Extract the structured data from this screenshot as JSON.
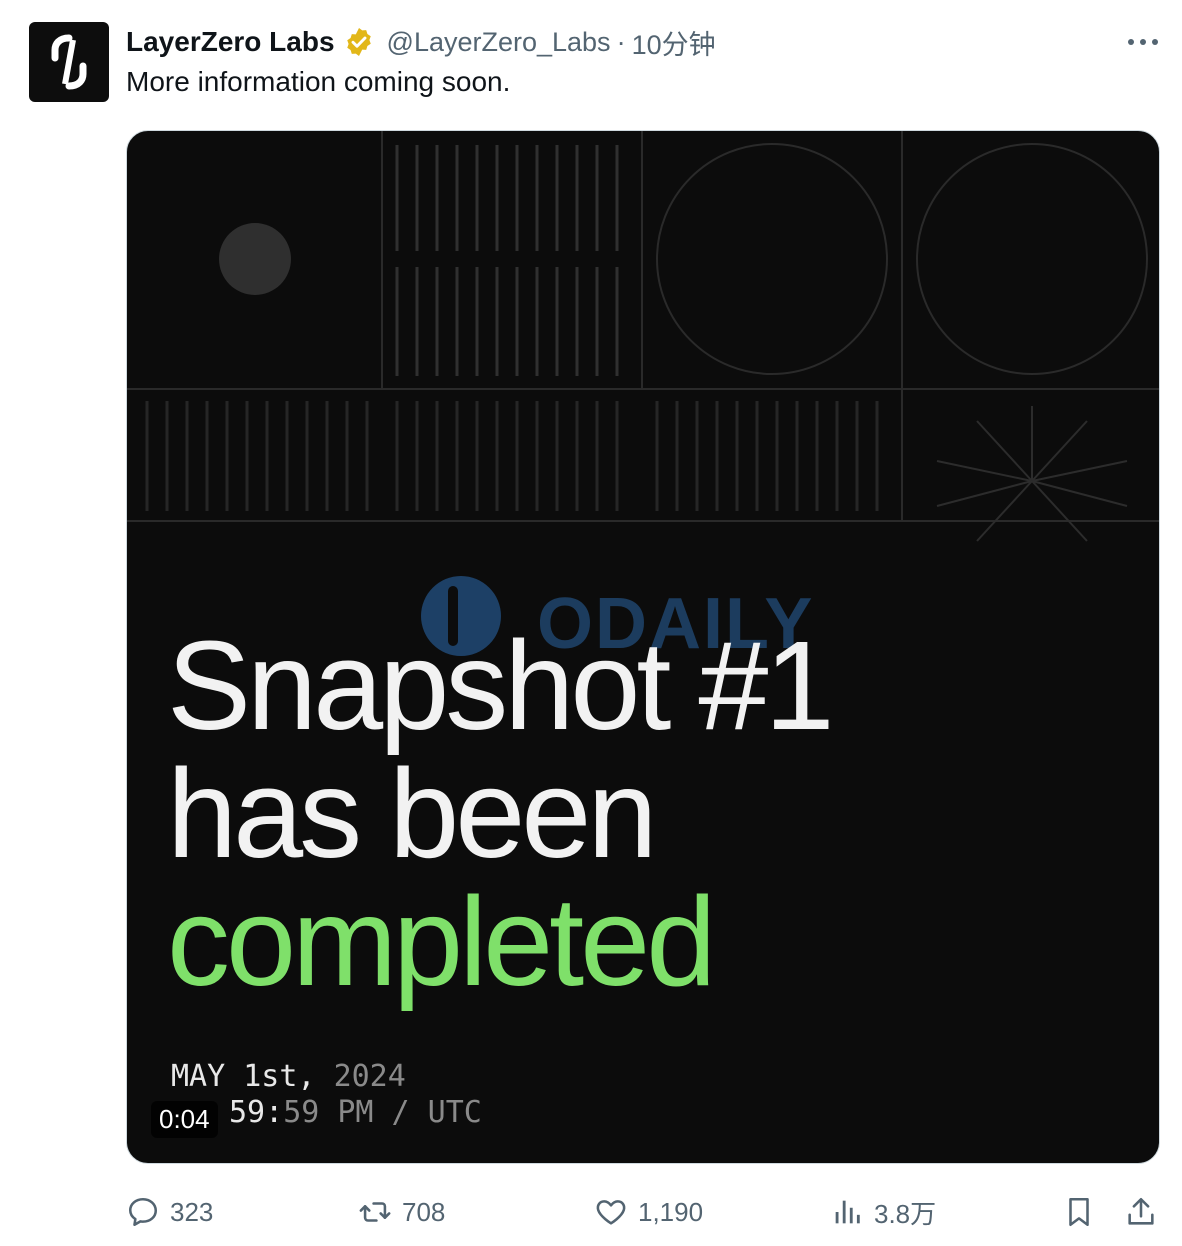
{
  "tweet": {
    "author_name": "LayerZero Labs",
    "handle": "@LayerZero_Labs",
    "separator": "·",
    "time": "10分钟",
    "text": "More information coming soon.",
    "verified_color": "#e2b719"
  },
  "media": {
    "headline_line1": "Snapshot #1",
    "headline_line2": "has been",
    "headline_line3": "completed",
    "date_bright": "MAY 1st,",
    "date_dim": "2024",
    "time_bright": "59:",
    "time_dim": "59 PM / UTC",
    "duration": "0:04",
    "watermark": "ODAILY",
    "accent_color": "#7fe06a"
  },
  "actions": {
    "replies": "323",
    "retweets": "708",
    "likes": "1,190",
    "views": "3.8万"
  }
}
